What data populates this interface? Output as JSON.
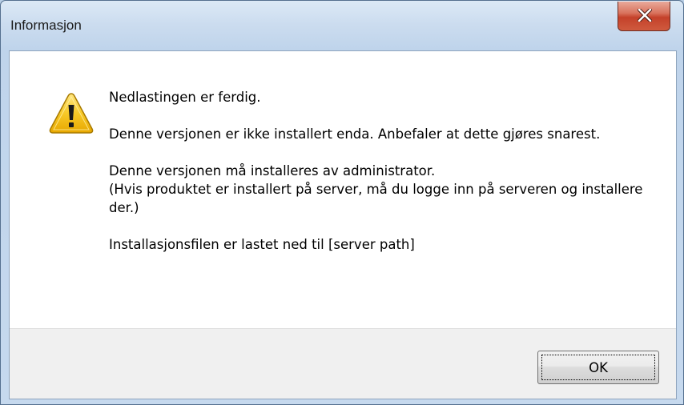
{
  "window": {
    "title": "Informasjon"
  },
  "icon": {
    "type": "warning-icon"
  },
  "message": {
    "line1": "Nedlastingen er ferdig.",
    "line2": "Denne versjonen er ikke installert enda. Anbefaler at dette gjøres snarest.",
    "line3": "Denne versjonen må installeres av administrator.",
    "line4": "(Hvis produktet er installert på server, må du logge inn på serveren og installere der.)",
    "line5": "Installasjonsfilen er lastet ned til [server path]"
  },
  "buttons": {
    "ok_label": "OK"
  },
  "colors": {
    "close_button": "#c4412a",
    "warning_fill": "#f5c518"
  }
}
